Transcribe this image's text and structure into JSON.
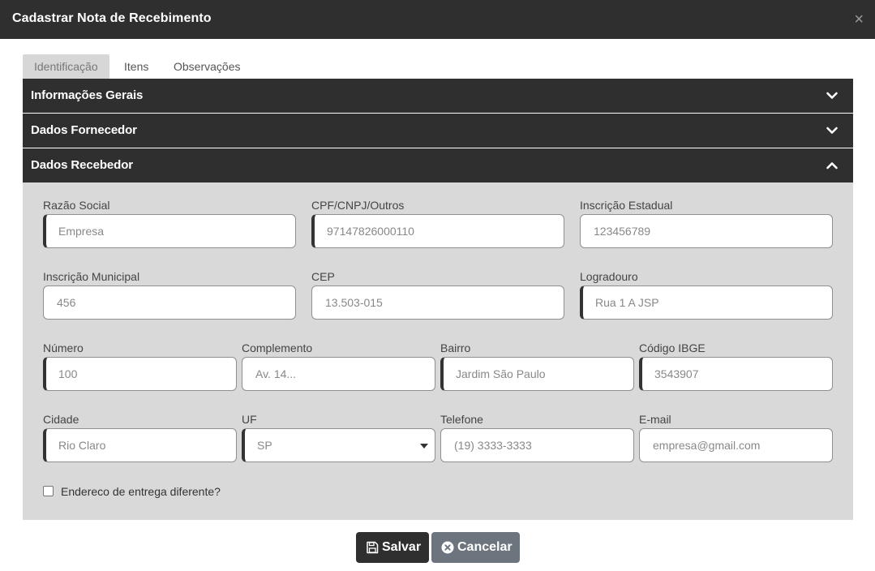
{
  "header": {
    "title": "Cadastrar Nota de Recebimento",
    "close_glyph": "×"
  },
  "tabs": [
    {
      "label": "Identificação",
      "active": true
    },
    {
      "label": "Itens",
      "active": false
    },
    {
      "label": "Observações",
      "active": false
    }
  ],
  "sections": [
    {
      "title": "Informações Gerais",
      "expanded": false,
      "icon": "chevron-down-icon"
    },
    {
      "title": "Dados Fornecedor",
      "expanded": false,
      "icon": "chevron-down-icon"
    },
    {
      "title": "Dados Recebedor",
      "expanded": true,
      "icon": "chevron-up-icon"
    }
  ],
  "form": {
    "razao_social": {
      "label": "Razão Social",
      "placeholder": "Empresa"
    },
    "cpf_cnpj": {
      "label": "CPF/CNPJ/Outros",
      "value": "97147826000110"
    },
    "inscricao_estadual": {
      "label": "Inscrição Estadual",
      "value": "123456789"
    },
    "inscricao_municipal": {
      "label": "Inscrição Municipal",
      "value": "456"
    },
    "cep": {
      "label": "CEP",
      "value": "13.503-015"
    },
    "logradouro": {
      "label": "Logradouro",
      "value": "Rua 1 A JSP"
    },
    "numero": {
      "label": "Número",
      "value": "100"
    },
    "complemento": {
      "label": "Complemento",
      "placeholder": "Av. 14..."
    },
    "bairro": {
      "label": "Bairro",
      "value": "Jardim São Paulo"
    },
    "codigo_ibge": {
      "label": "Código IBGE",
      "value": "3543907"
    },
    "cidade": {
      "label": "Cidade",
      "value": "Rio Claro"
    },
    "uf": {
      "label": "UF",
      "value": "SP"
    },
    "telefone": {
      "label": "Telefone",
      "value": "(19) 3333-3333"
    },
    "email": {
      "label": "E-mail",
      "value": "empresa@gmail.com"
    },
    "endereco_diferente": {
      "label": "Endereco de entrega diferente?",
      "checked": false
    }
  },
  "buttons": {
    "save_label": "Salvar",
    "cancel_label": "Cancelar"
  },
  "colors": {
    "dark": "#2f2f2f",
    "panel": "#d9d9d9",
    "cancel": "#6c757d"
  }
}
